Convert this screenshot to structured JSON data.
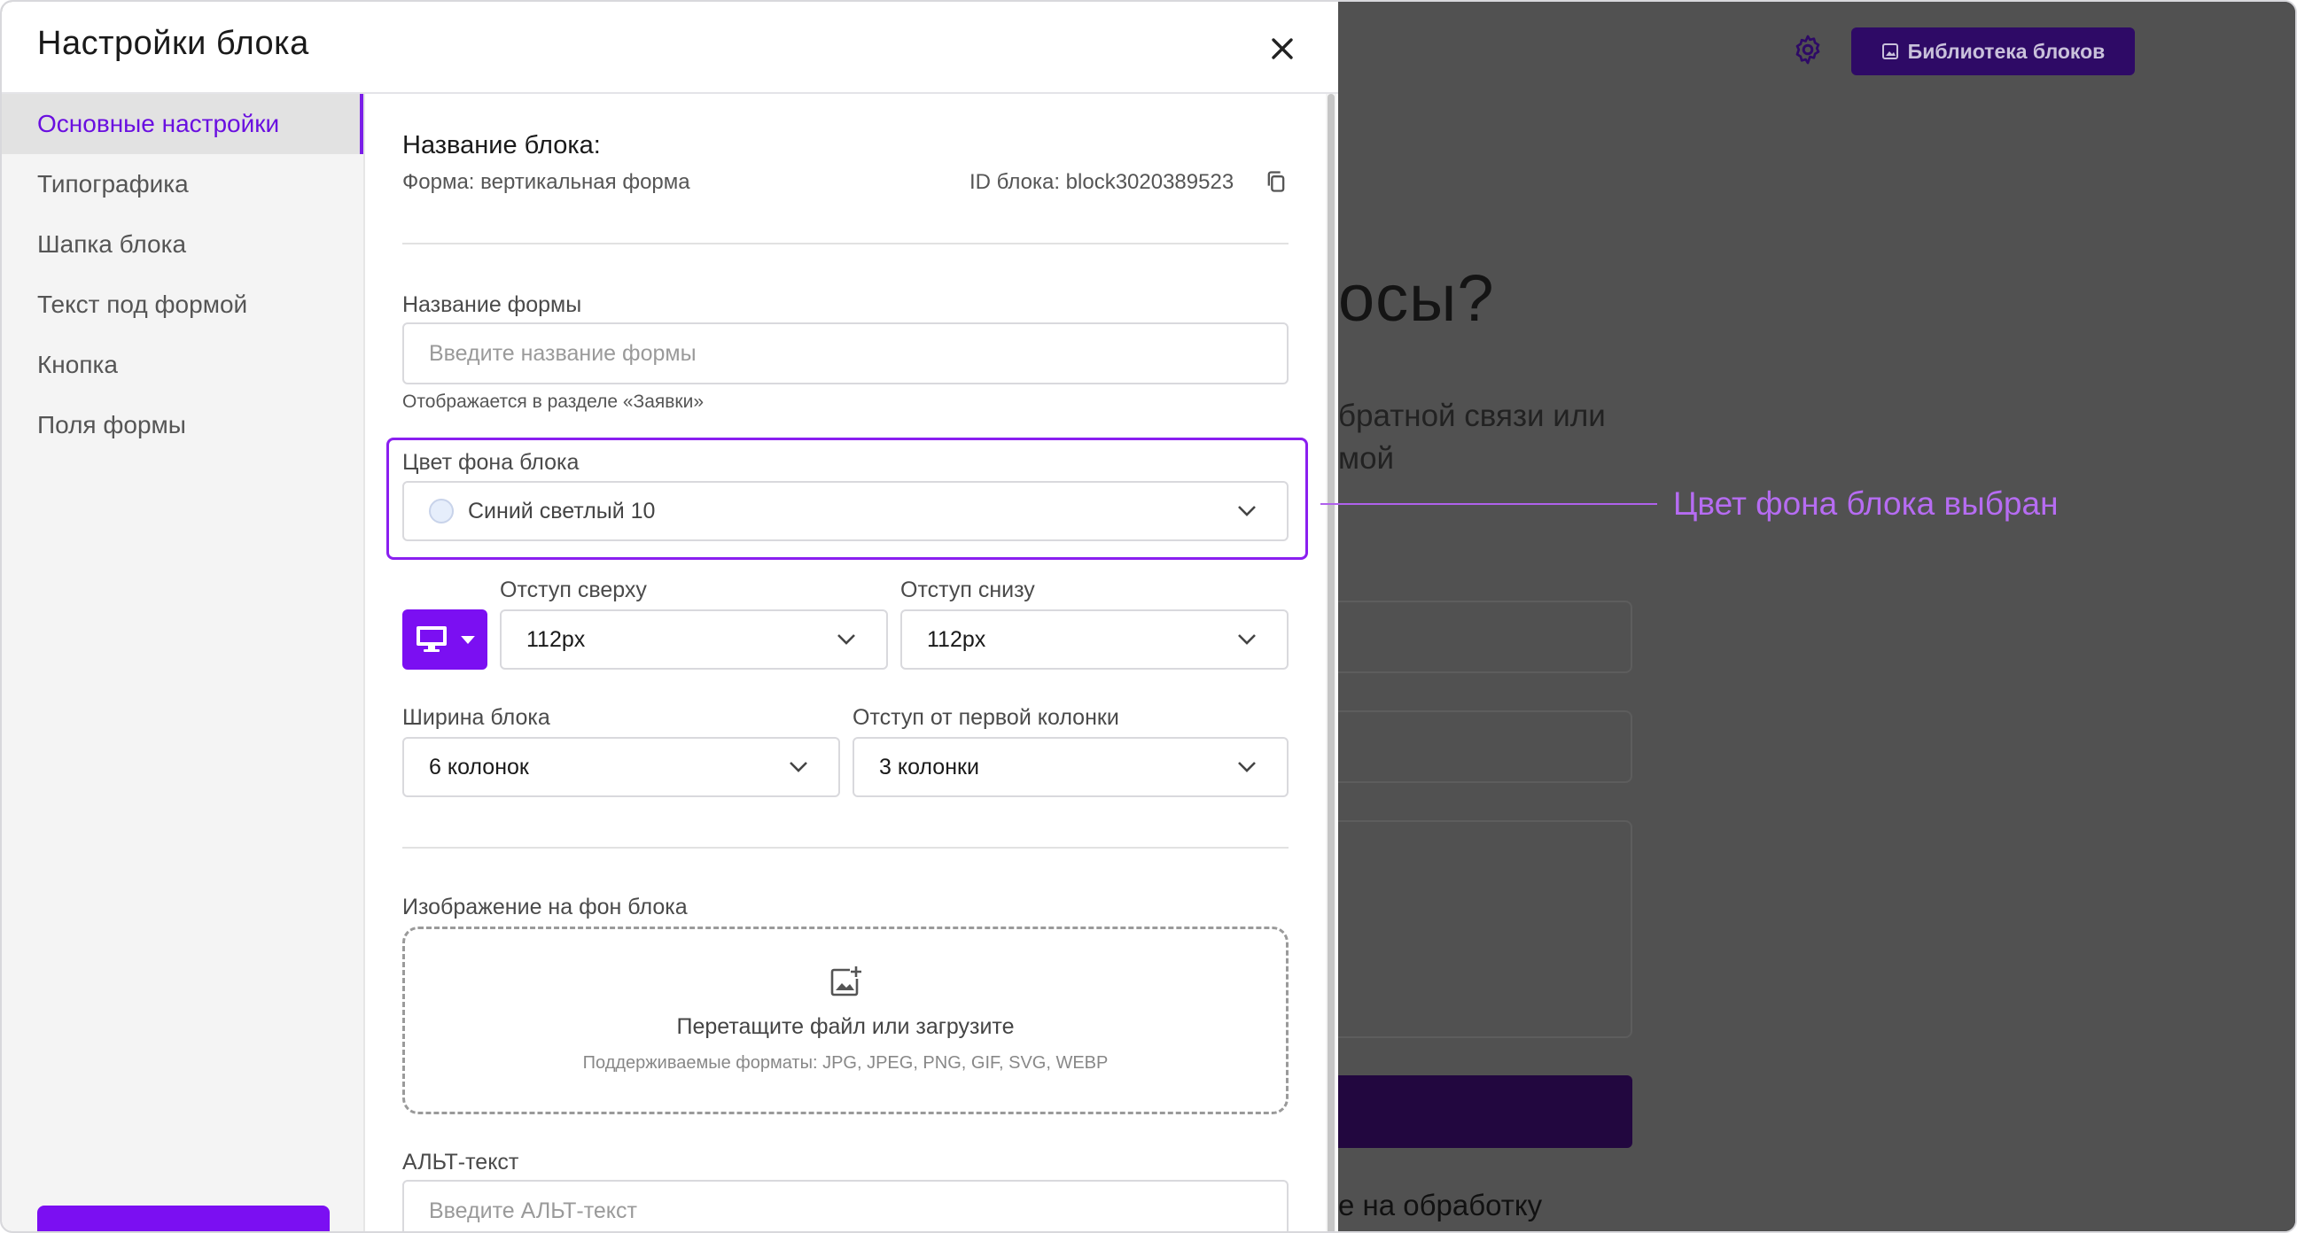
{
  "background": {
    "library_button_label": "Библиотека блоков",
    "heading_fragment": "осы?",
    "subtitle_line1": "братной связи или",
    "subtitle_line2": "мой",
    "note_fragment": "е на обработку"
  },
  "annotation": {
    "text": "Цвет фона блока выбран",
    "color": "#b66cf2"
  },
  "modal": {
    "title": "Настройки блока",
    "nav": [
      {
        "label": "Основные настройки",
        "active": true
      },
      {
        "label": "Типографика"
      },
      {
        "label": "Шапка блока"
      },
      {
        "label": "Текст под формой"
      },
      {
        "label": "Кнопка"
      },
      {
        "label": "Поля формы"
      }
    ],
    "block_title_label": "Название блока:",
    "block_type": "Форма: вертикальная форма",
    "block_id": "ID блока: block3020389523",
    "form_name": {
      "label": "Название формы",
      "placeholder": "Введите название формы",
      "hint": "Отображается в разделе «Заявки»"
    },
    "bg_color": {
      "label": "Цвет фона блока",
      "value": "Синий светлый 10",
      "swatch": "#e6eefb"
    },
    "padding_top": {
      "label": "Отступ сверху",
      "value": "112px"
    },
    "padding_bottom": {
      "label": "Отступ снизу",
      "value": "112px"
    },
    "block_width": {
      "label": "Ширина блока",
      "value": "6 колонок"
    },
    "first_column_offset": {
      "label": "Отступ от первой колонки",
      "value": "3 колонки"
    },
    "bg_image": {
      "label": "Изображение на фон блока",
      "drop_text": "Перетащите файл или загрузите",
      "formats": "Поддерживаемые форматы: JPG, JPEG, PNG, GIF, SVG, WEBP"
    },
    "alt_text": {
      "label": "АЛЬТ-текст",
      "placeholder": "Введите АЛЬТ-текст"
    }
  },
  "colors": {
    "accent": "#7b0ff2",
    "highlight_border": "#8a1ff0",
    "overlay": "#515151"
  }
}
